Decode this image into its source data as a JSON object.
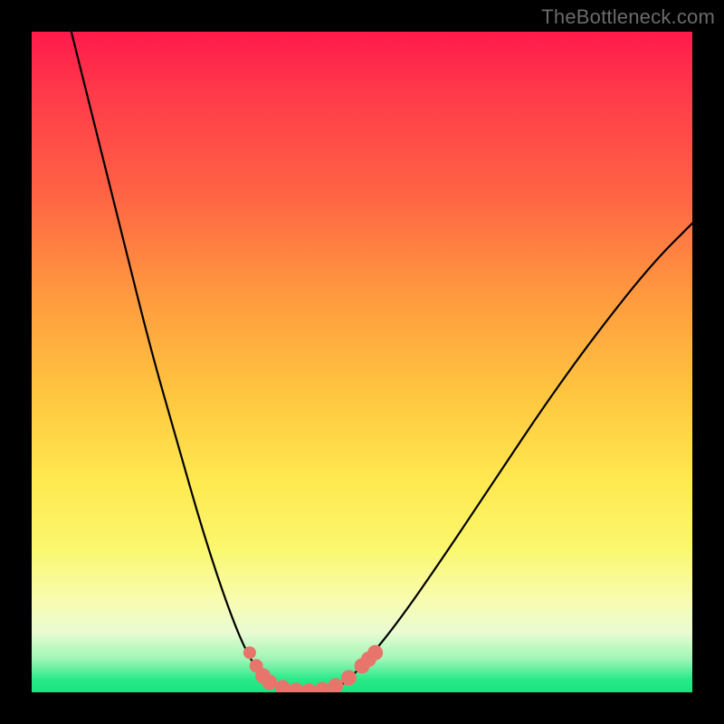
{
  "watermark": "TheBottleneck.com",
  "chart_data": {
    "type": "line",
    "title": "",
    "xlabel": "",
    "ylabel": "",
    "xlim": [
      0,
      100
    ],
    "ylim": [
      0,
      100
    ],
    "grid": false,
    "legend": false,
    "gradient_stops": [
      {
        "pos": 0,
        "color": "#ff1a4b"
      },
      {
        "pos": 10,
        "color": "#ff3c4a"
      },
      {
        "pos": 25,
        "color": "#ff6544"
      },
      {
        "pos": 40,
        "color": "#ff9a3f"
      },
      {
        "pos": 55,
        "color": "#ffc63f"
      },
      {
        "pos": 68,
        "color": "#ffe950"
      },
      {
        "pos": 78,
        "color": "#fbf76c"
      },
      {
        "pos": 86,
        "color": "#f8fcb0"
      },
      {
        "pos": 91,
        "color": "#e9fbd2"
      },
      {
        "pos": 95,
        "color": "#9ef6b5"
      },
      {
        "pos": 98,
        "color": "#2bea8a"
      },
      {
        "pos": 100,
        "color": "#18e37d"
      }
    ],
    "series": [
      {
        "name": "bottleneck-curve",
        "color": "#000000",
        "points": [
          {
            "x": 6,
            "y": 100
          },
          {
            "x": 10,
            "y": 84
          },
          {
            "x": 14,
            "y": 68
          },
          {
            "x": 18,
            "y": 52
          },
          {
            "x": 22,
            "y": 38
          },
          {
            "x": 26,
            "y": 24
          },
          {
            "x": 30,
            "y": 12
          },
          {
            "x": 33,
            "y": 5
          },
          {
            "x": 36,
            "y": 1
          },
          {
            "x": 40,
            "y": 0
          },
          {
            "x": 44,
            "y": 0
          },
          {
            "x": 47,
            "y": 1
          },
          {
            "x": 50,
            "y": 4
          },
          {
            "x": 55,
            "y": 10
          },
          {
            "x": 62,
            "y": 20
          },
          {
            "x": 70,
            "y": 32
          },
          {
            "x": 78,
            "y": 44
          },
          {
            "x": 86,
            "y": 55
          },
          {
            "x": 94,
            "y": 65
          },
          {
            "x": 100,
            "y": 71
          }
        ]
      },
      {
        "name": "highlight-markers",
        "color": "#e8756b",
        "points": [
          {
            "x": 33,
            "y": 6
          },
          {
            "x": 34,
            "y": 4
          },
          {
            "x": 35,
            "y": 2.5
          },
          {
            "x": 36,
            "y": 1.5
          },
          {
            "x": 38,
            "y": 0.7
          },
          {
            "x": 40,
            "y": 0.3
          },
          {
            "x": 42,
            "y": 0.2
          },
          {
            "x": 44,
            "y": 0.4
          },
          {
            "x": 46,
            "y": 1
          },
          {
            "x": 48,
            "y": 2.2
          },
          {
            "x": 50,
            "y": 4
          },
          {
            "x": 51,
            "y": 5
          },
          {
            "x": 52,
            "y": 6
          }
        ]
      }
    ]
  }
}
